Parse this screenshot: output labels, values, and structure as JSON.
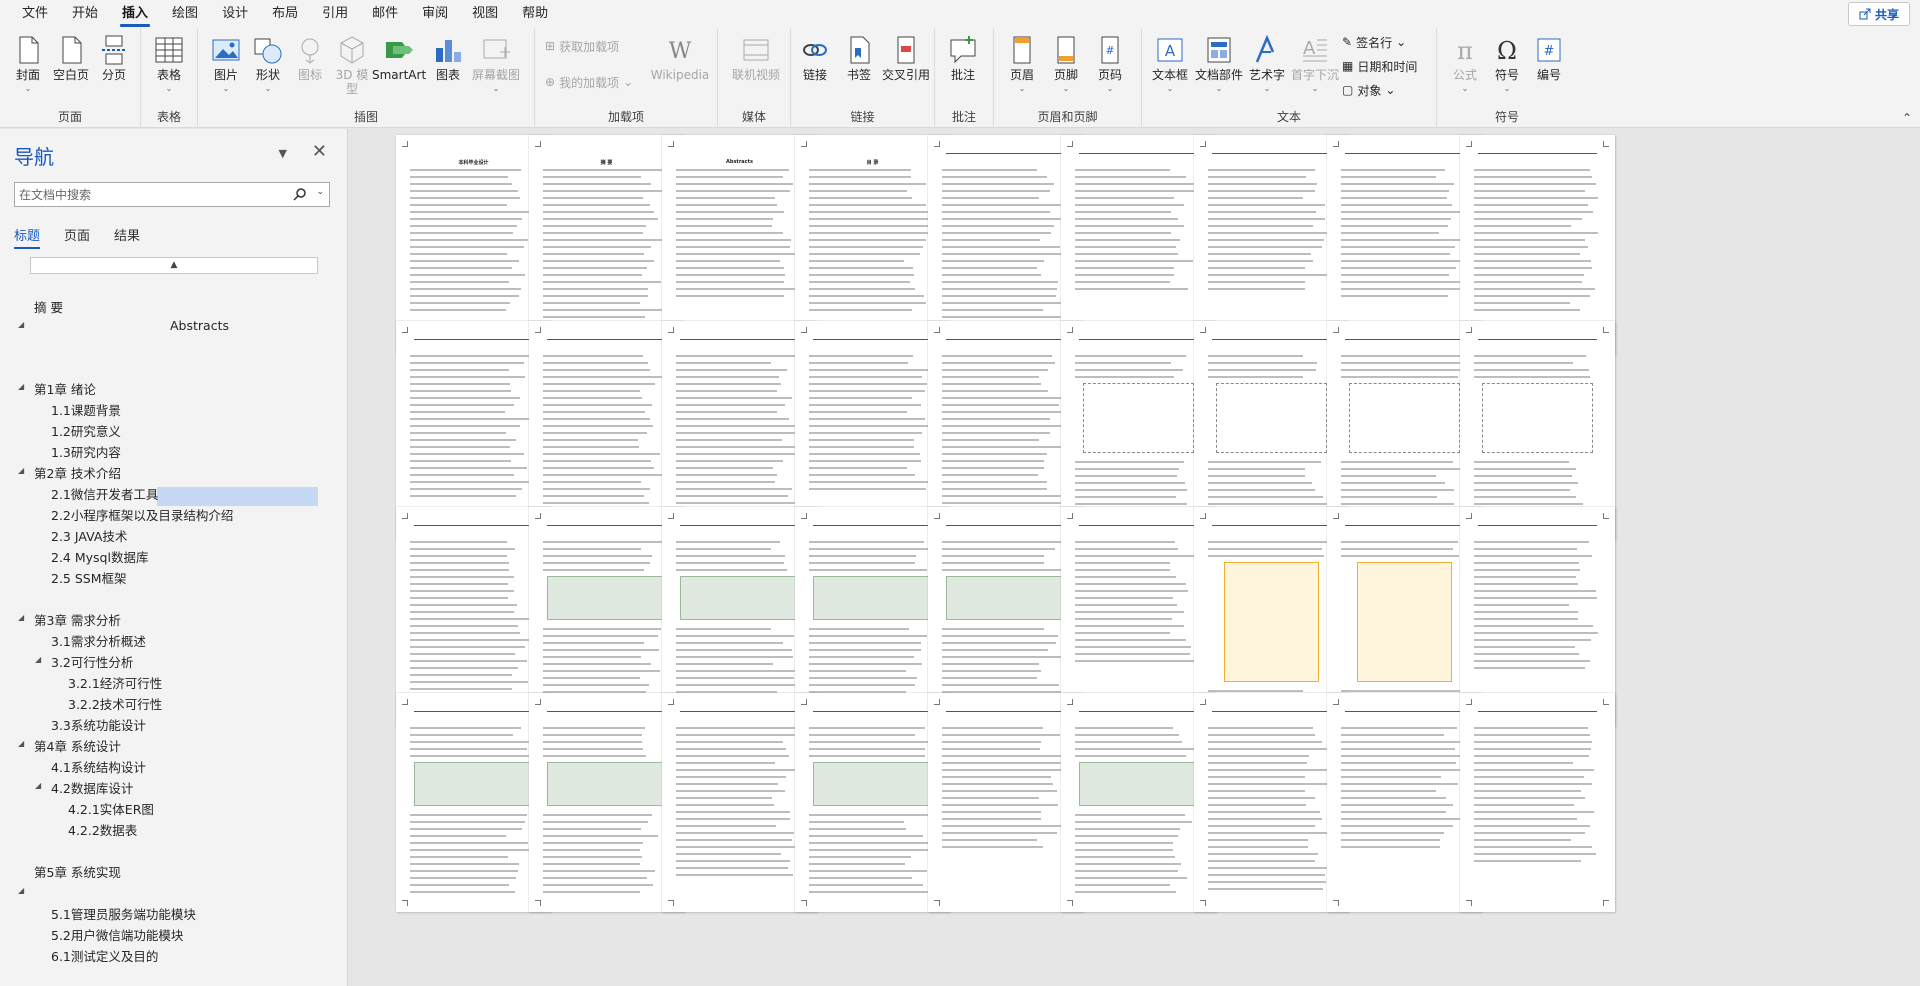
{
  "menu": {
    "tabs": [
      "文件",
      "开始",
      "插入",
      "绘图",
      "设计",
      "布局",
      "引用",
      "邮件",
      "审阅",
      "视图",
      "帮助"
    ],
    "active": "插入",
    "share": "共享"
  },
  "ribbon": {
    "groups": {
      "pages": "页面",
      "tables": "表格",
      "illustrations": "插图",
      "addins": "加载项",
      "media": "媒体",
      "links": "链接",
      "comments": "批注",
      "header_footer": "页眉和页脚",
      "text": "文本",
      "symbols": "符号"
    },
    "buttons": {
      "cover": "封面",
      "blank_page": "空白页",
      "page_break": "分页",
      "table": "表格",
      "pictures": "图片",
      "shapes": "形状",
      "icons": "图标",
      "model3d": "3D 模型",
      "smartart": "SmartArt",
      "chart": "图表",
      "screenshot": "屏幕截图",
      "get_addins": "获取加载项",
      "my_addins": "我的加载项",
      "wikipedia": "Wikipedia",
      "online_video": "联机视频",
      "link": "链接",
      "bookmark": "书签",
      "cross_ref": "交叉引用",
      "comment": "批注",
      "header": "页眉",
      "footer": "页脚",
      "page_number": "页码",
      "textbox": "文本框",
      "quick_parts": "文档部件",
      "wordart": "艺术字",
      "drop_cap": "首字下沉",
      "signature": "签名行",
      "datetime": "日期和时间",
      "object": "对象",
      "equation": "公式",
      "symbol": "符号",
      "numbering": "编号"
    }
  },
  "nav": {
    "title": "导航",
    "search_placeholder": "在文档中搜索",
    "tabs": [
      "标题",
      "页面",
      "结果"
    ],
    "items": [
      {
        "text": "摘  要"
      },
      {
        "text": "Abstracts"
      },
      {
        "text": "第1章 绪论"
      },
      {
        "text": "1.1课题背景"
      },
      {
        "text": "1.2研究意义"
      },
      {
        "text": "1.3研究内容"
      },
      {
        "text": "第2章 技术介绍"
      },
      {
        "text": "2.1微信开发者工具"
      },
      {
        "text": "2.2小程序框架以及目录结构介绍"
      },
      {
        "text": "2.3 JAVA技术"
      },
      {
        "text": "2.4   Mysql数据库"
      },
      {
        "text": "2.5 SSM框架"
      },
      {
        "text": "第3章 需求分析"
      },
      {
        "text": "3.1需求分析概述"
      },
      {
        "text": "3.2可行性分析"
      },
      {
        "text": "3.2.1经济可行性"
      },
      {
        "text": "3.2.2技术可行性"
      },
      {
        "text": "3.3系统功能设计"
      },
      {
        "text": "第4章 系统设计"
      },
      {
        "text": "4.1系统结构设计"
      },
      {
        "text": "4.2数据库设计"
      },
      {
        "text": "4.2.1实体ER图"
      },
      {
        "text": "4.2.2数据表"
      },
      {
        "text": "第5章 系统实现"
      },
      {
        "text": "5.1管理员服务端功能模块"
      },
      {
        "text": "5.2用户微信端功能模块"
      },
      {
        "text": "6.1测试定义及目的"
      }
    ]
  },
  "pages": {
    "p1_title": "本科毕业设计",
    "p2_title": "摘  要",
    "p3_title": "Abstracts",
    "p4_title": "目  录"
  }
}
